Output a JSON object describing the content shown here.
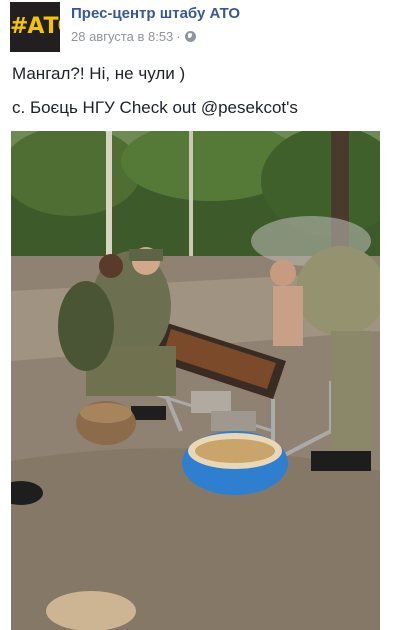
{
  "post": {
    "page_name": "Прес-центр штабу АТО",
    "avatar_text": "#АТО",
    "timestamp": "28 августа в 8:53",
    "separator": "·",
    "privacy_icon": "globe-icon",
    "text_line_1": "Мангал?! Ні, не чули )",
    "text_line_2": "с. Боєць НГУ Check out @pesekcot's"
  },
  "colors": {
    "page_name": "#365899",
    "meta_text": "#90949c",
    "avatar_bg": "#231f20",
    "avatar_text": "#f5c400"
  }
}
